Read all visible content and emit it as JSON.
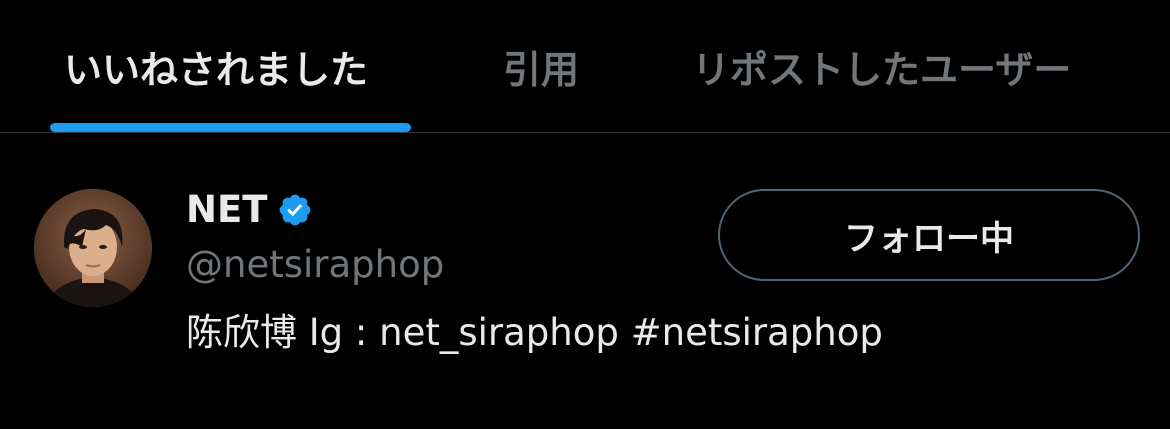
{
  "tabs": [
    {
      "label": "いいねされました",
      "active": true
    },
    {
      "label": "引用",
      "active": false
    },
    {
      "label": "リポストしたユーザー",
      "active": false
    }
  ],
  "accent_color": "#1d9bf0",
  "user": {
    "display_name": "NET",
    "verified": true,
    "verified_icon": "verified-badge-icon",
    "handle": "@netsiraphop",
    "bio": "陈欣博 Ig : net_siraphop #netsiraphop",
    "avatar_icon": "profile-photo",
    "follow_button_label": "フォロー中"
  }
}
